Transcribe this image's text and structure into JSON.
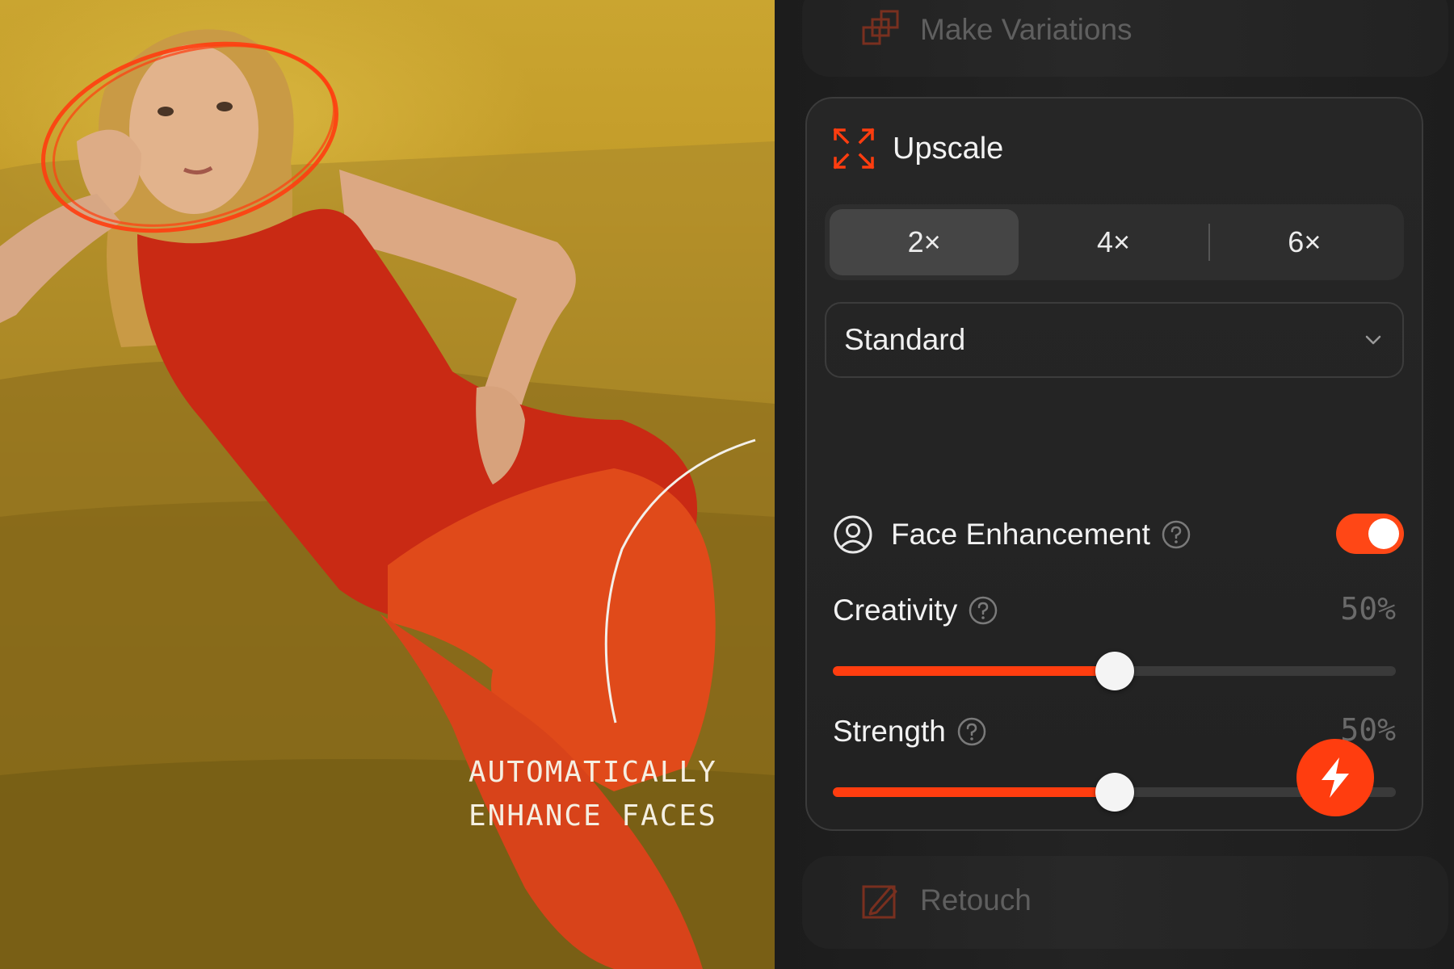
{
  "photo": {
    "caption_line1": "AUTOMATICALLY",
    "caption_line2": "ENHANCE FACES"
  },
  "panel": {
    "variations": {
      "label": "Make Variations",
      "icon": "variations-icon"
    },
    "upscale": {
      "title": "Upscale",
      "icon": "upscale-icon",
      "scales": [
        {
          "label": "2×",
          "selected": true
        },
        {
          "label": "4×",
          "selected": false
        },
        {
          "label": "6×",
          "selected": false
        }
      ],
      "mode": {
        "value": "Standard"
      },
      "face_enhancement": {
        "label": "Face Enhancement",
        "enabled": true
      },
      "creativity": {
        "label": "Creativity",
        "value_text": "50%",
        "value": 0.5
      },
      "strength": {
        "label": "Strength",
        "value_text": "50%",
        "value": 0.5
      }
    },
    "retouch": {
      "label": "Retouch",
      "icon": "retouch-icon"
    }
  },
  "colors": {
    "accent": "#FF3D0F",
    "panel_bg": "#1F1F1F",
    "card_border": "#3B3B3B",
    "photo_wall": "#C9A22F",
    "dress": "#C92A14"
  }
}
